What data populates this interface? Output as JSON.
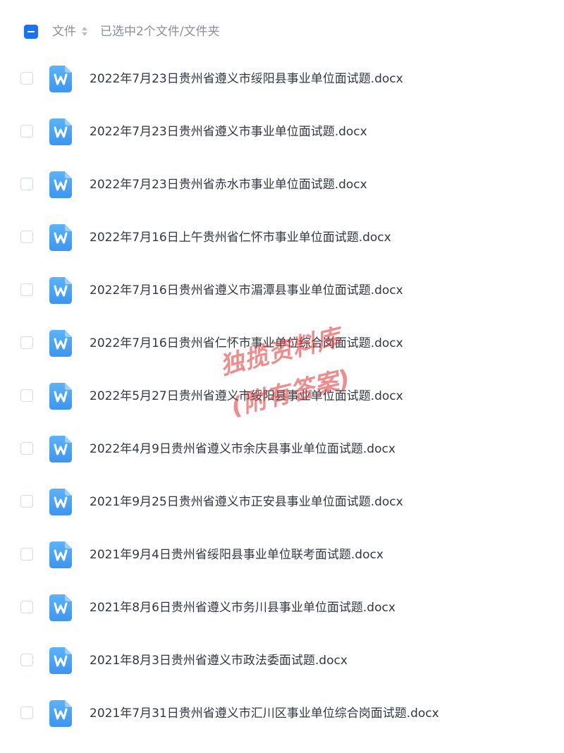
{
  "header": {
    "column_label": "文件",
    "selection_status": "已选中2个文件/文件夹",
    "select_all_state": "indeterminate"
  },
  "file_icon": "word-docx-icon",
  "accent_color": "#1a73f5",
  "icon_color": "#4aa6f7",
  "files": [
    {
      "name": "2022年7月23日贵州省遵义市绥阳县事业单位面试题.docx"
    },
    {
      "name": "2022年7月23日贵州省遵义市事业单位面试题.docx"
    },
    {
      "name": "2022年7月23日贵州省赤水市事业单位面试题.docx"
    },
    {
      "name": "2022年7月16日上午贵州省仁怀市事业单位面试题.docx"
    },
    {
      "name": "2022年7月16日贵州省遵义市湄潭县事业单位面试题.docx"
    },
    {
      "name": "2022年7月16日贵州省仁怀市事业单位综合岗面试题.docx"
    },
    {
      "name": "2022年5月27日贵州省遵义市绥阳县事业单位面试题.docx"
    },
    {
      "name": "2022年4月9日贵州省遵义市余庆县事业单位面试题.docx"
    },
    {
      "name": "2021年9月25日贵州省遵义市正安县事业单位面试题.docx"
    },
    {
      "name": "2021年9月4日贵州省绥阳县事业单位联考面试题.docx"
    },
    {
      "name": "2021年8月6日贵州省遵义市务川县事业单位面试题.docx"
    },
    {
      "name": "2021年8月3日贵州省遵义市政法委面试题.docx"
    },
    {
      "name": "2021年7月31日贵州省遵义市汇川区事业单位综合岗面试题.docx"
    }
  ],
  "watermark": {
    "line1": "独揽资料库",
    "line2": "(附有答案)"
  }
}
